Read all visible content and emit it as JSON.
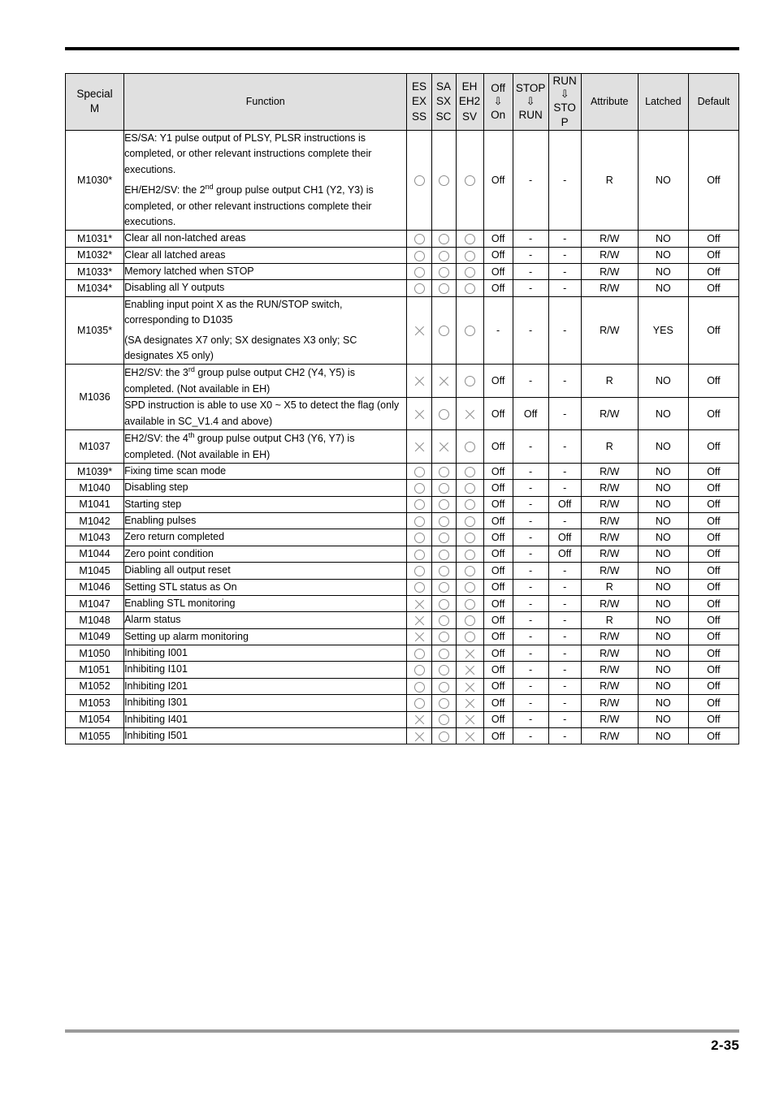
{
  "page": {
    "page_number": "2-35"
  },
  "table": {
    "headers": {
      "special_m": [
        "Special",
        "M"
      ],
      "function": "Function",
      "col_es": [
        "ES",
        "EX",
        "SS"
      ],
      "col_sa": [
        "SA",
        "SX",
        "SC"
      ],
      "col_eh": [
        "EH",
        "EH2",
        "SV"
      ],
      "col_off_on": [
        "Off",
        "⇩",
        "On"
      ],
      "col_stop_run": [
        "STOP",
        "⇩",
        "RUN"
      ],
      "col_run_stop": [
        "RUN",
        "⇩",
        "STO",
        "P"
      ],
      "attribute": "Attribute",
      "latched": "Latched",
      "default": "Default"
    },
    "rows": [
      {
        "code": "M1030*",
        "function_paragraphs": [
          "ES/SA: Y1 pulse output of PLSY, PLSR instructions is completed, or other relevant instructions complete their executions.",
          "EH/EH2/SV: the 2<sup>nd</sup> group pulse output CH1 (Y2, Y3) is completed, or other relevant instructions complete their executions."
        ],
        "es": "circle",
        "sa": "circle",
        "eh": "circle",
        "off_on": "Off",
        "stop_run": "-",
        "run_stop": "-",
        "attribute": "R",
        "latched": "NO",
        "default": "Off"
      },
      {
        "code": "M1031*",
        "function_paragraphs": [
          "Clear all non-latched areas"
        ],
        "es": "circle",
        "sa": "circle",
        "eh": "circle",
        "off_on": "Off",
        "stop_run": "-",
        "run_stop": "-",
        "attribute": "R/W",
        "latched": "NO",
        "default": "Off"
      },
      {
        "code": "M1032*",
        "function_paragraphs": [
          "Clear all latched areas"
        ],
        "es": "circle",
        "sa": "circle",
        "eh": "circle",
        "off_on": "Off",
        "stop_run": "-",
        "run_stop": "-",
        "attribute": "R/W",
        "latched": "NO",
        "default": "Off"
      },
      {
        "code": "M1033*",
        "function_paragraphs": [
          "Memory latched when STOP"
        ],
        "es": "circle",
        "sa": "circle",
        "eh": "circle",
        "off_on": "Off",
        "stop_run": "-",
        "run_stop": "-",
        "attribute": "R/W",
        "latched": "NO",
        "default": "Off"
      },
      {
        "code": "M1034*",
        "function_paragraphs": [
          "Disabling all Y outputs"
        ],
        "es": "circle",
        "sa": "circle",
        "eh": "circle",
        "off_on": "Off",
        "stop_run": "-",
        "run_stop": "-",
        "attribute": "R/W",
        "latched": "NO",
        "default": "Off"
      },
      {
        "code": "M1035*",
        "function_paragraphs": [
          "Enabling input point X as the RUN/STOP switch, corresponding to D1035",
          "(SA designates X7 only; SX designates X3 only; SC designates X5 only)"
        ],
        "es": "cross",
        "sa": "circle",
        "eh": "circle",
        "off_on": "-",
        "stop_run": "-",
        "run_stop": "-",
        "attribute": "R/W",
        "latched": "YES",
        "default": "Off"
      },
      {
        "code": "M1036",
        "code_rowspan": 2,
        "function_paragraphs": [
          "EH2/SV: the 3<sup>rd</sup> group pulse output CH2 (Y4, Y5) is completed. (Not available in EH)"
        ],
        "es": "cross",
        "sa": "cross",
        "eh": "circle",
        "off_on": "Off",
        "stop_run": "-",
        "run_stop": "-",
        "attribute": "R",
        "latched": "NO",
        "default": "Off"
      },
      {
        "code": null,
        "function_paragraphs": [
          "SPD instruction is able to use X0 ~ X5 to detect the flag (only available in SC_V1.4 and above)"
        ],
        "es": "cross",
        "sa": "circle",
        "eh": "cross",
        "off_on": "Off",
        "stop_run": "Off",
        "run_stop": "-",
        "attribute": "R/W",
        "latched": "NO",
        "default": "Off"
      },
      {
        "code": "M1037",
        "function_paragraphs": [
          "EH2/SV: the 4<sup>th</sup> group pulse output CH3 (Y6, Y7) is completed. (Not available in EH)"
        ],
        "es": "cross",
        "sa": "cross",
        "eh": "circle",
        "off_on": "Off",
        "stop_run": "-",
        "run_stop": "-",
        "attribute": "R",
        "latched": "NO",
        "default": "Off"
      },
      {
        "code": "M1039*",
        "function_paragraphs": [
          "Fixing time scan mode"
        ],
        "es": "circle",
        "sa": "circle",
        "eh": "circle",
        "off_on": "Off",
        "stop_run": "-",
        "run_stop": "-",
        "attribute": "R/W",
        "latched": "NO",
        "default": "Off"
      },
      {
        "code": "M1040",
        "function_paragraphs": [
          "Disabling step"
        ],
        "es": "circle",
        "sa": "circle",
        "eh": "circle",
        "off_on": "Off",
        "stop_run": "-",
        "run_stop": "-",
        "attribute": "R/W",
        "latched": "NO",
        "default": "Off"
      },
      {
        "code": "M1041",
        "function_paragraphs": [
          "Starting step"
        ],
        "es": "circle",
        "sa": "circle",
        "eh": "circle",
        "off_on": "Off",
        "stop_run": "-",
        "run_stop": "Off",
        "attribute": "R/W",
        "latched": "NO",
        "default": "Off"
      },
      {
        "code": "M1042",
        "function_paragraphs": [
          "Enabling pulses"
        ],
        "es": "circle",
        "sa": "circle",
        "eh": "circle",
        "off_on": "Off",
        "stop_run": "-",
        "run_stop": "-",
        "attribute": "R/W",
        "latched": "NO",
        "default": "Off"
      },
      {
        "code": "M1043",
        "function_paragraphs": [
          "Zero return completed"
        ],
        "es": "circle",
        "sa": "circle",
        "eh": "circle",
        "off_on": "Off",
        "stop_run": "-",
        "run_stop": "Off",
        "attribute": "R/W",
        "latched": "NO",
        "default": "Off"
      },
      {
        "code": "M1044",
        "function_paragraphs": [
          "Zero point condition"
        ],
        "es": "circle",
        "sa": "circle",
        "eh": "circle",
        "off_on": "Off",
        "stop_run": "-",
        "run_stop": "Off",
        "attribute": "R/W",
        "latched": "NO",
        "default": "Off"
      },
      {
        "code": "M1045",
        "function_paragraphs": [
          "Diabling all output reset"
        ],
        "es": "circle",
        "sa": "circle",
        "eh": "circle",
        "off_on": "Off",
        "stop_run": "-",
        "run_stop": "-",
        "attribute": "R/W",
        "latched": "NO",
        "default": "Off"
      },
      {
        "code": "M1046",
        "function_paragraphs": [
          "Setting STL status as On"
        ],
        "es": "circle",
        "sa": "circle",
        "eh": "circle",
        "off_on": "Off",
        "stop_run": "-",
        "run_stop": "-",
        "attribute": "R",
        "latched": "NO",
        "default": "Off"
      },
      {
        "code": "M1047",
        "function_paragraphs": [
          "Enabling STL monitoring"
        ],
        "es": "cross",
        "sa": "circle",
        "eh": "circle",
        "off_on": "Off",
        "stop_run": "-",
        "run_stop": "-",
        "attribute": "R/W",
        "latched": "NO",
        "default": "Off"
      },
      {
        "code": "M1048",
        "function_paragraphs": [
          "Alarm status"
        ],
        "es": "cross",
        "sa": "circle",
        "eh": "circle",
        "off_on": "Off",
        "stop_run": "-",
        "run_stop": "-",
        "attribute": "R",
        "latched": "NO",
        "default": "Off"
      },
      {
        "code": "M1049",
        "function_paragraphs": [
          "Setting up alarm monitoring"
        ],
        "es": "cross",
        "sa": "circle",
        "eh": "circle",
        "off_on": "Off",
        "stop_run": "-",
        "run_stop": "-",
        "attribute": "R/W",
        "latched": "NO",
        "default": "Off"
      },
      {
        "code": "M1050",
        "function_paragraphs": [
          "Inhibiting I001"
        ],
        "es": "circle",
        "sa": "circle",
        "eh": "cross",
        "off_on": "Off",
        "stop_run": "-",
        "run_stop": "-",
        "attribute": "R/W",
        "latched": "NO",
        "default": "Off"
      },
      {
        "code": "M1051",
        "function_paragraphs": [
          "Inhibiting I101"
        ],
        "es": "circle",
        "sa": "circle",
        "eh": "cross",
        "off_on": "Off",
        "stop_run": "-",
        "run_stop": "-",
        "attribute": "R/W",
        "latched": "NO",
        "default": "Off"
      },
      {
        "code": "M1052",
        "function_paragraphs": [
          "Inhibiting I201"
        ],
        "es": "circle",
        "sa": "circle",
        "eh": "cross",
        "off_on": "Off",
        "stop_run": "-",
        "run_stop": "-",
        "attribute": "R/W",
        "latched": "NO",
        "default": "Off"
      },
      {
        "code": "M1053",
        "function_paragraphs": [
          "Inhibiting I301"
        ],
        "es": "circle",
        "sa": "circle",
        "eh": "cross",
        "off_on": "Off",
        "stop_run": "-",
        "run_stop": "-",
        "attribute": "R/W",
        "latched": "NO",
        "default": "Off"
      },
      {
        "code": "M1054",
        "function_paragraphs": [
          "Inhibiting I401"
        ],
        "es": "cross",
        "sa": "circle",
        "eh": "cross",
        "off_on": "Off",
        "stop_run": "-",
        "run_stop": "-",
        "attribute": "R/W",
        "latched": "NO",
        "default": "Off"
      },
      {
        "code": "M1055",
        "function_paragraphs": [
          "Inhibiting I501"
        ],
        "es": "cross",
        "sa": "circle",
        "eh": "cross",
        "off_on": "Off",
        "stop_run": "-",
        "run_stop": "-",
        "attribute": "R/W",
        "latched": "NO",
        "default": "Off"
      }
    ]
  }
}
